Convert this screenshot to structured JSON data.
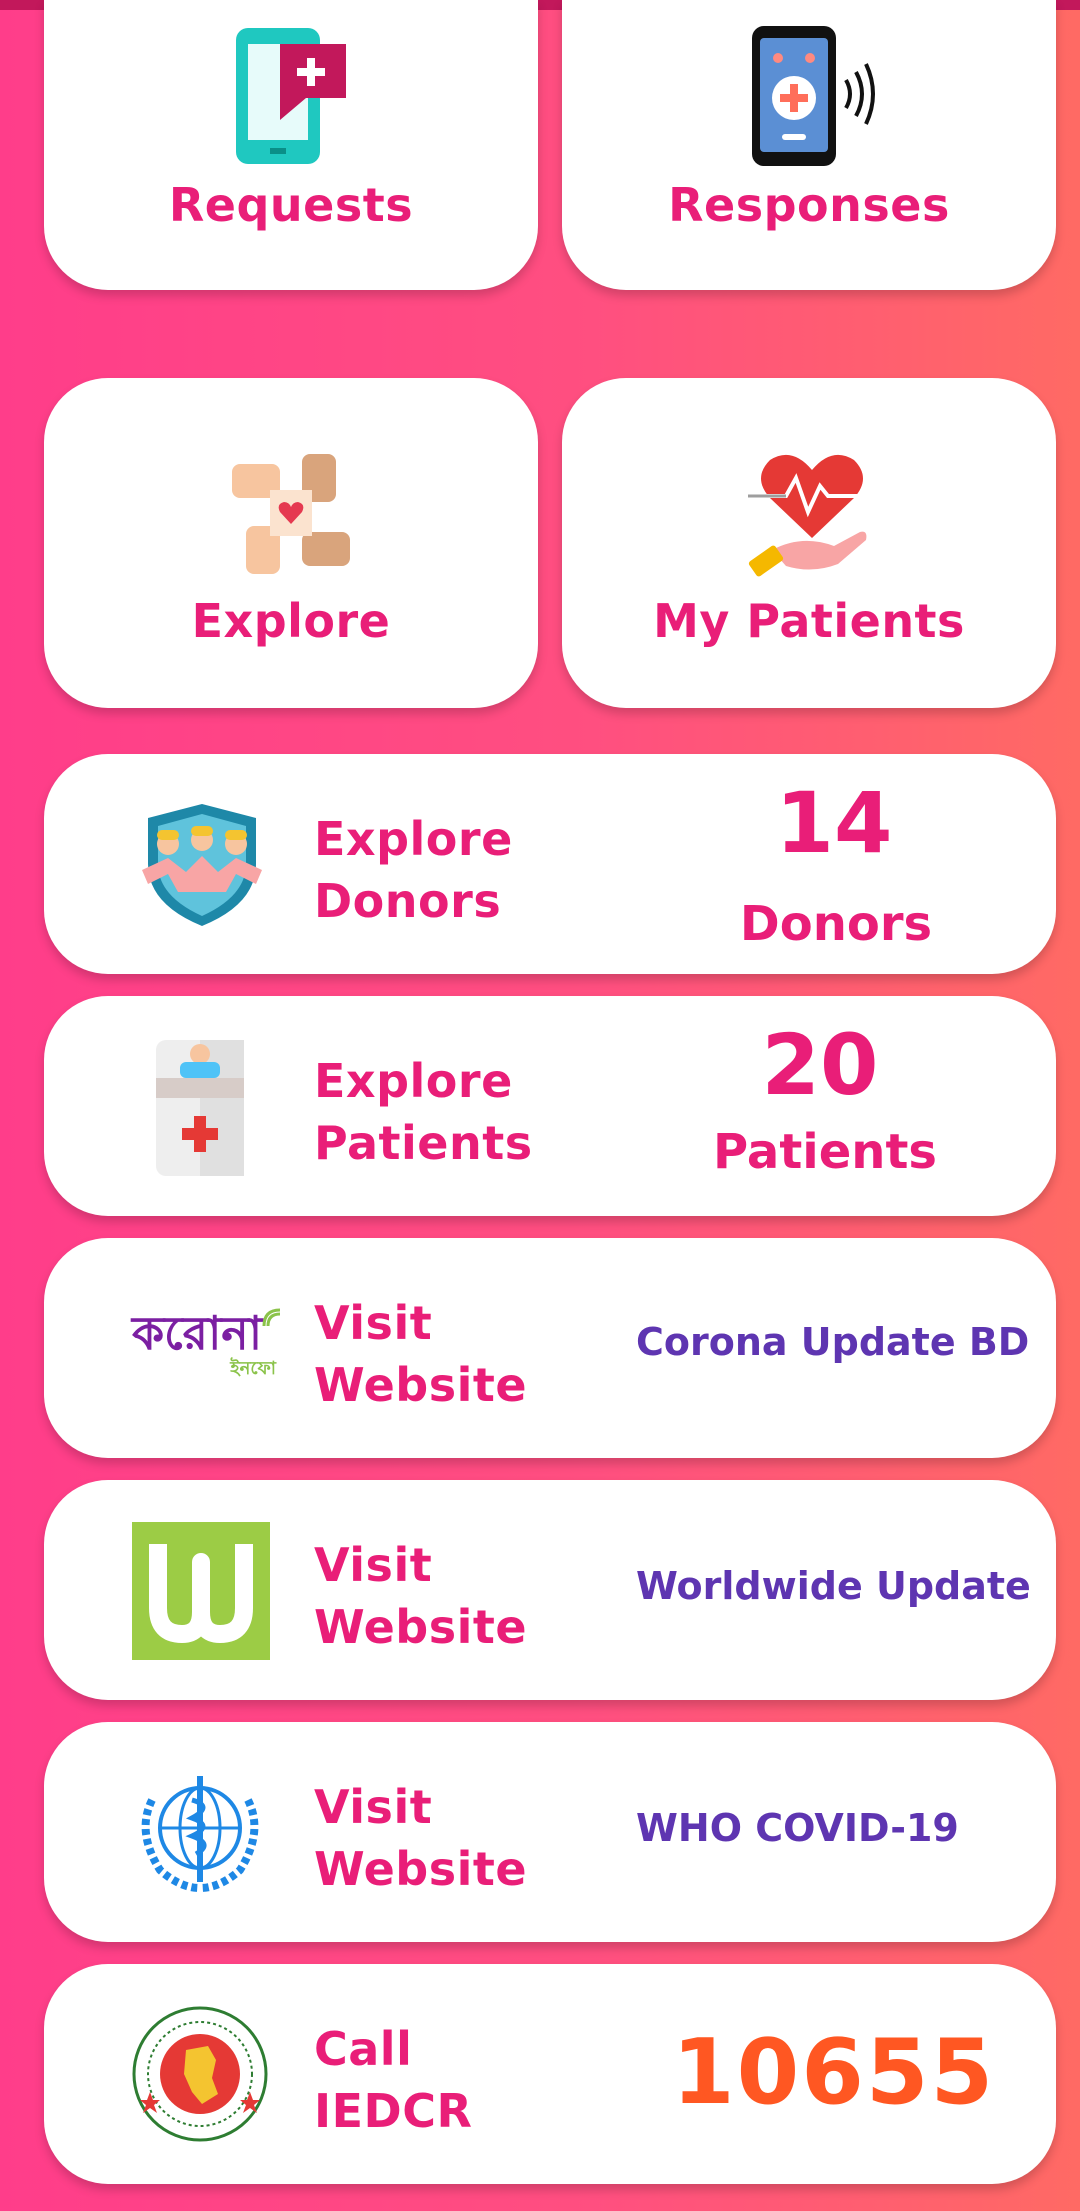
{
  "tiles": {
    "requests": {
      "label": "Requests"
    },
    "responses": {
      "label": "Responses"
    },
    "explore": {
      "label": "Explore"
    },
    "my_patients": {
      "label": "My Patients"
    }
  },
  "donors_card": {
    "line1": "Explore",
    "line2": "Donors",
    "count": "14",
    "unit": "Donors"
  },
  "patients_card": {
    "line1": "Explore",
    "line2": "Patients",
    "count": "20",
    "unit": "Patients"
  },
  "corona_card": {
    "line1": "Visit",
    "line2": "Website",
    "site": "Corona Update BD",
    "logo_text": "করোনা",
    "logo_sub": "ইনফো"
  },
  "worldwide_card": {
    "line1": "Visit",
    "line2": "Website",
    "site": "Worldwide Update",
    "logo_letter": "W"
  },
  "who_card": {
    "line1": "Visit",
    "line2": "Website",
    "site": "WHO COVID-19"
  },
  "call_card": {
    "line1": "Call",
    "line2": "IEDCR",
    "number": "10655"
  },
  "colors": {
    "accent_pink": "#e91e78",
    "site_purple": "#5e35b1",
    "hotline_orange": "#ff5722"
  }
}
